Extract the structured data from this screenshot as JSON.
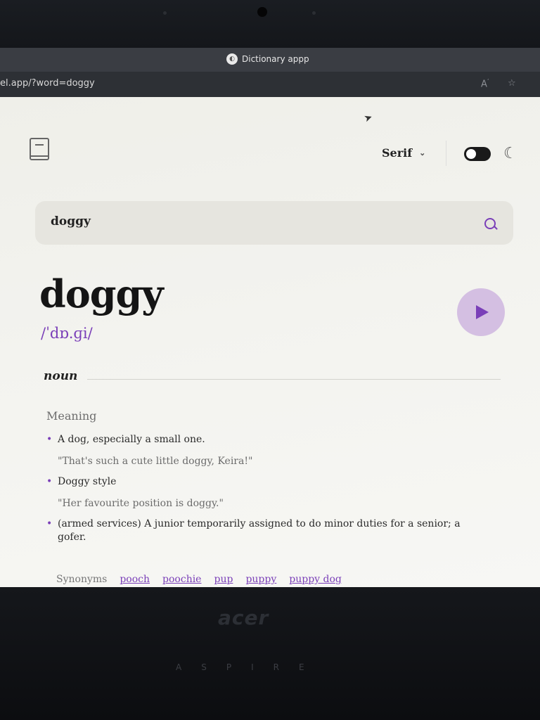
{
  "browser": {
    "tab_title": "Dictionary appp",
    "url": "el.app/?word=doggy"
  },
  "header": {
    "font_label": "Serif"
  },
  "search": {
    "value": "doggy"
  },
  "entry": {
    "word": "doggy",
    "phonetic": "/ˈdɒ.ɡi/",
    "part_of_speech": "noun",
    "meaning_heading": "Meaning",
    "definitions": [
      {
        "text": "A dog, especially a small one.",
        "example": "\"That's such a cute little doggy, Keira!\""
      },
      {
        "text": "Doggy style",
        "example": "\"Her favourite position is doggy.\""
      },
      {
        "text": "(armed services) A junior temporarily assigned to do minor duties for a senior; a gofer.",
        "example": ""
      }
    ],
    "synonyms_label": "Synonyms",
    "synonyms": [
      "pooch",
      "poochie",
      "pup",
      "puppy",
      "puppy dog"
    ]
  },
  "laptop": {
    "brand": "acer",
    "model": "ASPIRE"
  },
  "colors": {
    "accent": "#7a3fb8",
    "play_bg": "#d4bfe2"
  }
}
